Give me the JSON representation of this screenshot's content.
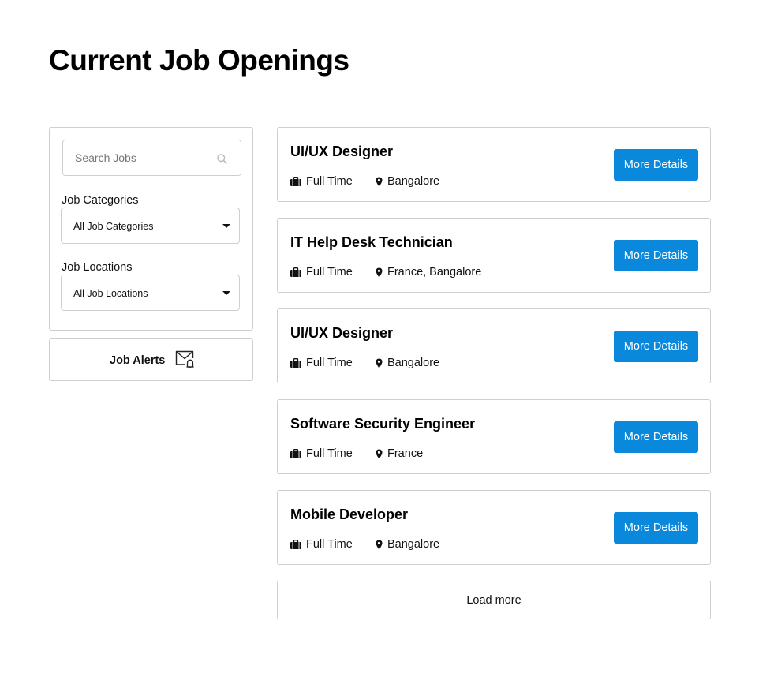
{
  "page": {
    "title": "Current Job Openings"
  },
  "sidebar": {
    "search": {
      "placeholder": "Search Jobs",
      "value": "",
      "icon": "search-icon"
    },
    "categories": {
      "label": "Job Categories",
      "selected": "All Job Categories"
    },
    "locations": {
      "label": "Job Locations",
      "selected": "All Job Locations"
    },
    "alerts": {
      "label": "Job Alerts",
      "icon": "mail-bell-icon"
    }
  },
  "jobs": [
    {
      "title": "UI/UX Designer",
      "type": "Full Time",
      "location": "Bangalore",
      "button": "More Details"
    },
    {
      "title": "IT Help Desk Technician",
      "type": "Full Time",
      "location": "France, Bangalore",
      "button": "More Details"
    },
    {
      "title": "UI/UX Designer",
      "type": "Full Time",
      "location": "Bangalore",
      "button": "More Details"
    },
    {
      "title": "Software Security Engineer",
      "type": "Full Time",
      "location": "France",
      "button": "More Details"
    },
    {
      "title": "Mobile Developer",
      "type": "Full Time",
      "location": "Bangalore",
      "button": "More Details"
    }
  ],
  "load_more_label": "Load more",
  "colors": {
    "primary_button": "#0a88dc",
    "border": "#cfcfcf"
  }
}
